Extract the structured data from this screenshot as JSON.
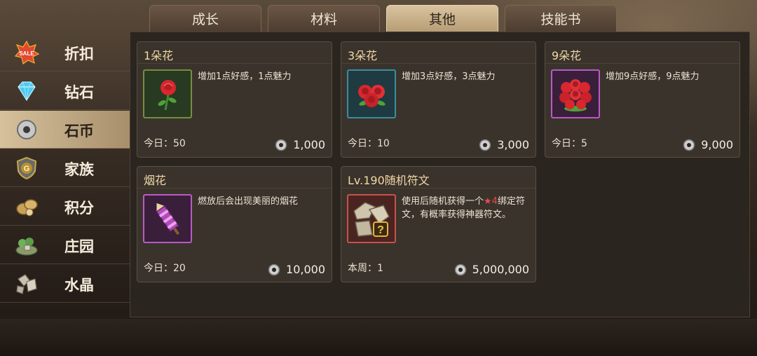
{
  "tabs": [
    {
      "label": "成长"
    },
    {
      "label": "材料"
    },
    {
      "label": "其他"
    },
    {
      "label": "技能书"
    }
  ],
  "active_tab": "其他",
  "sidebar": {
    "items": [
      {
        "label": "折扣",
        "icon": "sale-icon"
      },
      {
        "label": "钻石",
        "icon": "diamond-icon"
      },
      {
        "label": "石币",
        "icon": "stone-coin-icon"
      },
      {
        "label": "家族",
        "icon": "family-emblem-icon"
      },
      {
        "label": "积分",
        "icon": "points-icon"
      },
      {
        "label": "庄园",
        "icon": "manor-icon"
      },
      {
        "label": "水晶",
        "icon": "crystal-icon"
      }
    ],
    "active": "石币",
    "sale_badge": "SALE"
  },
  "items": [
    {
      "title": "1朵花",
      "desc": "增加1点好感，1点魅力",
      "limit": "今日：50",
      "price": "1,000",
      "icon": "single-rose-icon"
    },
    {
      "title": "3朵花",
      "desc": "增加3点好感，3点魅力",
      "limit": "今日：10",
      "price": "3,000",
      "icon": "rose-bouquet-icon"
    },
    {
      "title": "9朵花",
      "desc": "增加9点好感，9点魅力",
      "limit": "今日：5",
      "price": "9,000",
      "icon": "large-rose-bouquet-icon"
    },
    {
      "title": "烟花",
      "desc": "燃放后会出现美丽的烟花",
      "limit": "今日：20",
      "price": "10,000",
      "icon": "firework-icon"
    },
    {
      "title": "Lv.190随机符文",
      "desc_before": "使用后随机获得一个",
      "desc_star": "★4",
      "desc_after": "绑定符文，有概率获得神器符文。",
      "limit": "本周：1",
      "price": "5,000,000",
      "icon": "random-rune-icon"
    }
  ],
  "colors": {
    "active_tab": "#d9c39e",
    "title_gold": "#f3d8a6",
    "star_red": "#e64b4b"
  }
}
